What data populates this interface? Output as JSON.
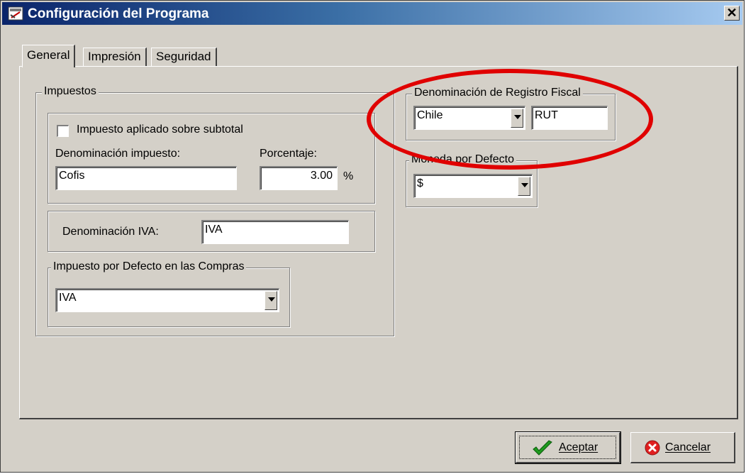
{
  "window": {
    "title": "Configuración del Programa",
    "close_label": "✕"
  },
  "tabs": [
    {
      "label": "General",
      "active": true
    },
    {
      "label": "Impresión",
      "active": false
    },
    {
      "label": "Seguridad",
      "active": false
    }
  ],
  "impuestos": {
    "group_label": "Impuestos",
    "subtotal_checkbox_label": "Impuesto aplicado sobre subtotal",
    "subtotal_checked": false,
    "denominacion_label": "Denominación impuesto:",
    "denominacion_value": "Cofis",
    "porcentaje_label": "Porcentaje:",
    "porcentaje_value": "3.00",
    "porcentaje_unit": "%",
    "iva_label": "Denominación IVA:",
    "iva_value": "IVA",
    "compras_group_label": "Impuesto por Defecto en las Compras",
    "compras_value": "IVA"
  },
  "registro_fiscal": {
    "group_label": "Denominación de Registro Fiscal",
    "country_value": "Chile",
    "id_value": "RUT"
  },
  "moneda": {
    "group_label": "Moneda por Defecto",
    "value": "$"
  },
  "buttons": {
    "accept_label": "Aceptar",
    "cancel_label": "Cancelar"
  },
  "colors": {
    "dialog_bg": "#d4d0c8",
    "title_start": "#0a246a",
    "title_end": "#a6caf0",
    "annotation": "#e00000",
    "accept_check": "#1f9a1f",
    "cancel_icon": "#e02020"
  }
}
